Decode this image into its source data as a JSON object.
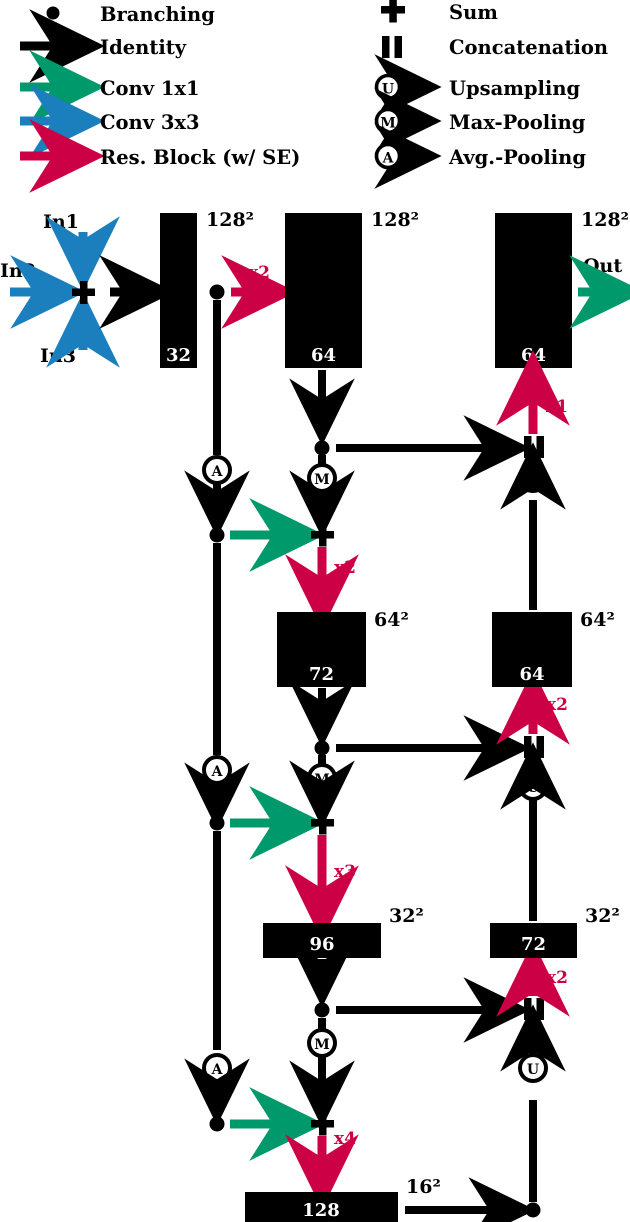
{
  "figure": {
    "type": "diagram",
    "subject": "U-Net style encoder-decoder neural network architecture",
    "colors": {
      "identity": "#000000",
      "conv1x1": "#00996b",
      "conv3x3": "#1b7fbd",
      "res_block": "#cc0044",
      "block_fill": "#000000",
      "block_text": "#ffffff",
      "background": "#ffffff"
    }
  },
  "legend": {
    "left_column": [
      {
        "icon": "branching-dot-icon",
        "label": "Branching",
        "kind": "dot",
        "color": "#000000"
      },
      {
        "icon": "identity-arrow-icon",
        "label": "Identity",
        "kind": "arrow",
        "color": "#000000"
      },
      {
        "icon": "conv1x1-arrow-icon",
        "label": "Conv 1x1",
        "kind": "arrow",
        "color": "#00996b"
      },
      {
        "icon": "conv3x3-arrow-icon",
        "label": "Conv 3x3",
        "kind": "arrow",
        "color": "#1b7fbd"
      },
      {
        "icon": "res-block-arrow-icon",
        "label": "Res. Block (w/ SE)",
        "kind": "arrow",
        "color": "#cc0044"
      }
    ],
    "right_column": [
      {
        "icon": "sum-plus-icon",
        "label": "Sum",
        "kind": "plus",
        "color": "#000000"
      },
      {
        "icon": "concatenation-bars-icon",
        "label": "Concatenation",
        "kind": "bars",
        "color": "#000000"
      },
      {
        "icon": "upsampling-icon",
        "label": "Upsampling",
        "kind": "circle-arrow",
        "glyph": "U",
        "color": "#000000"
      },
      {
        "icon": "max-pooling-icon",
        "label": "Max-Pooling",
        "kind": "circle-arrow",
        "glyph": "M",
        "color": "#000000"
      },
      {
        "icon": "avg-pooling-icon",
        "label": "Avg.-Pooling",
        "kind": "circle-arrow",
        "glyph": "A",
        "color": "#000000"
      }
    ]
  },
  "inputs": [
    {
      "name": "In1",
      "direction": "down",
      "edge": "conv3x3"
    },
    {
      "name": "In2",
      "direction": "right",
      "edge": "conv3x3"
    },
    {
      "name": "In3",
      "direction": "up",
      "edge": "conv3x3"
    }
  ],
  "output": {
    "name": "Out",
    "edge": "conv1x1"
  },
  "feature_blocks": [
    {
      "id": "enc-128-32",
      "channels": "32",
      "resolution": "128²",
      "column": "encoder",
      "level": "128"
    },
    {
      "id": "enc-128-64",
      "channels": "64",
      "resolution": "128²",
      "column": "encoder",
      "level": "128"
    },
    {
      "id": "dec-128-64",
      "channels": "64",
      "resolution": "128²",
      "column": "decoder",
      "level": "128"
    },
    {
      "id": "enc-64-72",
      "channels": "72",
      "resolution": "64²",
      "column": "encoder",
      "level": "64"
    },
    {
      "id": "dec-64-64",
      "channels": "64",
      "resolution": "64²",
      "column": "decoder",
      "level": "64"
    },
    {
      "id": "enc-32-96",
      "channels": "96",
      "resolution": "32²",
      "column": "encoder",
      "level": "32"
    },
    {
      "id": "dec-32-72",
      "channels": "72",
      "resolution": "32²",
      "column": "decoder",
      "level": "32"
    },
    {
      "id": "bottleneck-16-128",
      "channels": "128",
      "resolution": "16²",
      "column": "encoder",
      "level": "16"
    }
  ],
  "repeat_labels": [
    {
      "id": "rep-enc-128",
      "text": "x2",
      "attached_to": "enc-128-32 -> enc-128-64"
    },
    {
      "id": "rep-dec-128",
      "text": "x1",
      "attached_to": "concat-128 -> dec-128-64"
    },
    {
      "id": "rep-enc-64",
      "text": "x2",
      "attached_to": "sum-64 -> enc-64-72"
    },
    {
      "id": "rep-dec-64",
      "text": "x2",
      "attached_to": "concat-64 -> dec-64-64"
    },
    {
      "id": "rep-enc-32",
      "text": "x3",
      "attached_to": "sum-32 -> enc-32-96"
    },
    {
      "id": "rep-dec-32",
      "text": "x2",
      "attached_to": "concat-32 -> dec-32-72"
    },
    {
      "id": "rep-enc-16",
      "text": "x4",
      "attached_to": "sum-16 -> bottleneck-16-128"
    }
  ],
  "operator_nodes": [
    {
      "id": "sum-input",
      "type": "sum",
      "glyph": "+"
    },
    {
      "id": "branch-128",
      "type": "branching",
      "glyph": "●"
    },
    {
      "id": "branch-skip-128",
      "type": "branching",
      "glyph": "●"
    },
    {
      "id": "avgpool-128",
      "type": "avg-pooling",
      "glyph": "A"
    },
    {
      "id": "maxpool-128",
      "type": "max-pooling",
      "glyph": "M"
    },
    {
      "id": "branch-pool-128",
      "type": "branching",
      "glyph": "●"
    },
    {
      "id": "sum-64",
      "type": "sum",
      "glyph": "+"
    },
    {
      "id": "concat-128",
      "type": "concatenation",
      "glyph": "‖"
    },
    {
      "id": "upsample-128",
      "type": "upsampling",
      "glyph": "U"
    },
    {
      "id": "branch-skip-64",
      "type": "branching",
      "glyph": "●"
    },
    {
      "id": "avgpool-64",
      "type": "avg-pooling",
      "glyph": "A"
    },
    {
      "id": "maxpool-64",
      "type": "max-pooling",
      "glyph": "M"
    },
    {
      "id": "branch-pool-64",
      "type": "branching",
      "glyph": "●"
    },
    {
      "id": "sum-32",
      "type": "sum",
      "glyph": "+"
    },
    {
      "id": "concat-64",
      "type": "concatenation",
      "glyph": "‖"
    },
    {
      "id": "upsample-64",
      "type": "upsampling",
      "glyph": "U"
    },
    {
      "id": "branch-skip-32",
      "type": "branching",
      "glyph": "●"
    },
    {
      "id": "avgpool-32",
      "type": "avg-pooling",
      "glyph": "A"
    },
    {
      "id": "maxpool-32",
      "type": "max-pooling",
      "glyph": "M"
    },
    {
      "id": "branch-pool-32",
      "type": "branching",
      "glyph": "●"
    },
    {
      "id": "sum-16",
      "type": "sum",
      "glyph": "+"
    },
    {
      "id": "concat-32",
      "type": "concatenation",
      "glyph": "‖"
    },
    {
      "id": "upsample-32",
      "type": "upsampling",
      "glyph": "U"
    },
    {
      "id": "branch-bottleneck",
      "type": "branching",
      "glyph": "●"
    }
  ],
  "glyphs": {
    "sum": "+",
    "concat": "‖",
    "upsample": "U",
    "maxpool": "M",
    "avgpool": "A",
    "sup2": "2"
  },
  "resolution_labels": {
    "enc_128_a": "128²",
    "enc_128_b": "128²",
    "dec_128": "128²",
    "enc_64": "64²",
    "dec_64": "64²",
    "enc_32": "32²",
    "dec_32": "32²",
    "bottleneck_16": "16²"
  },
  "channel_labels": {
    "enc_128_a": "32",
    "enc_128_b": "64",
    "dec_128": "64",
    "enc_64": "72",
    "dec_64": "64",
    "enc_32": "96",
    "dec_32": "72",
    "bottleneck_16": "128"
  }
}
